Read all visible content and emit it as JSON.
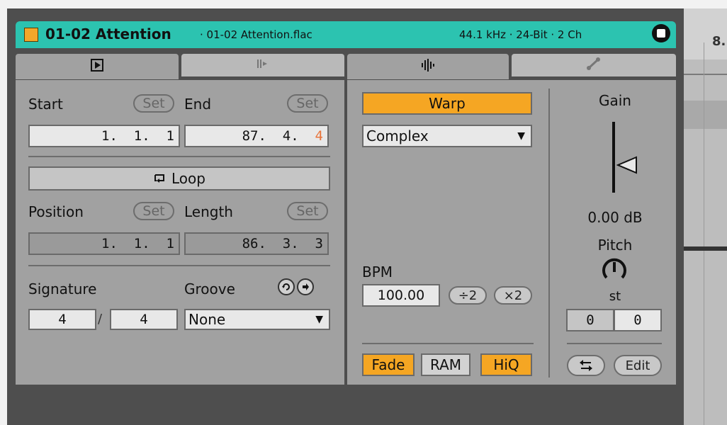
{
  "clip": {
    "name": "01-02 Attention",
    "file": "· 01-02 Attention.flac",
    "info": "44.1 kHz · 24-Bit · 2 Ch",
    "color": "#f4a72a"
  },
  "ruler": {
    "marker": "8."
  },
  "tabs": [
    {
      "icon": "play-square-icon"
    },
    {
      "icon": "envelope-icon"
    },
    {
      "icon": "waveform-icon"
    },
    {
      "icon": "wrench-icon"
    }
  ],
  "sample": {
    "start_label": "Start",
    "end_label": "End",
    "set_label": "Set",
    "start_value": "1.  1.  1",
    "end_value_main": "87.  4.  ",
    "end_value_last": "4",
    "loop_label": "Loop",
    "position_label": "Position",
    "length_label": "Length",
    "position_value": "1.  1.  1",
    "length_value": "86.  3.  3",
    "signature_label": "Signature",
    "groove_label": "Groove",
    "sig_num": "4",
    "sig_sep": "/",
    "sig_den": "4",
    "groove_value": "None"
  },
  "warp": {
    "warp_label": "Warp",
    "mode": "Complex",
    "bpm_label": "BPM",
    "bpm_value": "100.00",
    "half_label": "÷2",
    "double_label": "×2",
    "fade_label": "Fade",
    "ram_label": "RAM",
    "hiq_label": "HiQ"
  },
  "gain": {
    "gain_label": "Gain",
    "gain_value": "0.00 dB",
    "pitch_label": "Pitch",
    "pitch_unit": "st",
    "pitch_coarse": "0",
    "pitch_fine": "0",
    "edit_label": "Edit"
  },
  "colors": {
    "header": "#2cc3b0",
    "accent_orange": "#f5a623",
    "end_highlight": "#e8743b"
  }
}
